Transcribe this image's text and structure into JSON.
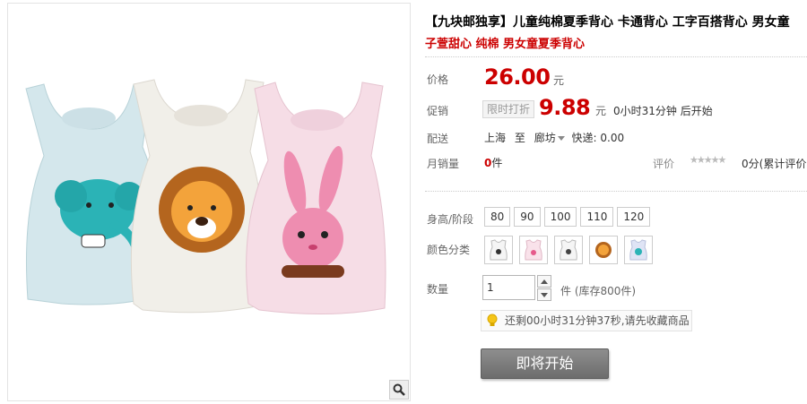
{
  "product": {
    "title": "【九块邮独享】儿童纯棉夏季背心 卡通背心 工字百搭背心 男女童",
    "subtitle": "子萱甜心 纯棉 男女童夏季背心"
  },
  "price": {
    "label": "价格",
    "value": "26.00",
    "unit": "元"
  },
  "promo": {
    "label": "促销",
    "tag": "限时打折",
    "value": "9.88",
    "unit": "元",
    "countdown": "0小时31分钟 后开始"
  },
  "shipping": {
    "label": "配送",
    "from": "上海",
    "to_word": "至",
    "to": "廊坊",
    "fee": "快递: 0.00"
  },
  "sales": {
    "label": "月销量",
    "count": "0",
    "unit": "件"
  },
  "rating": {
    "label": "评价",
    "stars": "★★★★★",
    "text": "0分(累计评价0"
  },
  "size": {
    "label": "身高/阶段",
    "options": [
      "80",
      "90",
      "100",
      "110",
      "120"
    ]
  },
  "color": {
    "label": "颜色分类",
    "options": [
      "elephant-vest",
      "rabbit-vest",
      "lion-vest",
      "lion-face-vest",
      "elephant-face-vest"
    ]
  },
  "quantity": {
    "label": "数量",
    "value": "1",
    "stock": "件 (库存800件)"
  },
  "tip": {
    "text": "还剩00小时31分钟37秒,请先收藏商品"
  },
  "buy_button": {
    "label": "即将开始"
  },
  "colors": {
    "price_red": "#cc0000",
    "button_gray": "#777777"
  }
}
